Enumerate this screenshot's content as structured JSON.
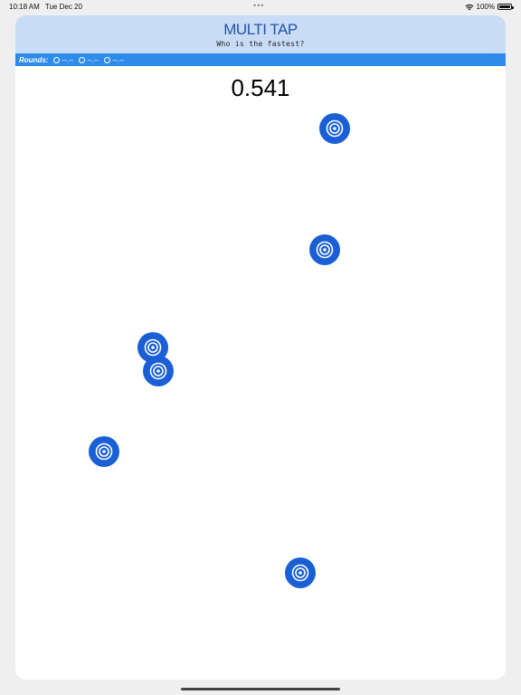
{
  "status_bar": {
    "time": "10:18 AM",
    "date": "Tue Dec 20",
    "dots": "•••",
    "battery": "100%"
  },
  "header": {
    "title": "MULTI TAP",
    "subtitle": "Who is the fastest?"
  },
  "rounds": {
    "label": "Rounds:",
    "values": [
      "--.--",
      "--.--",
      "--.--"
    ]
  },
  "timer": {
    "value": "0.541"
  },
  "targets": {
    "count": 6,
    "color": "#1a5fd6",
    "icon": "target-icon"
  },
  "colors": {
    "header_bg": "#c9dcf6",
    "rounds_bar": "#2f8bea",
    "title": "#2454a6"
  }
}
